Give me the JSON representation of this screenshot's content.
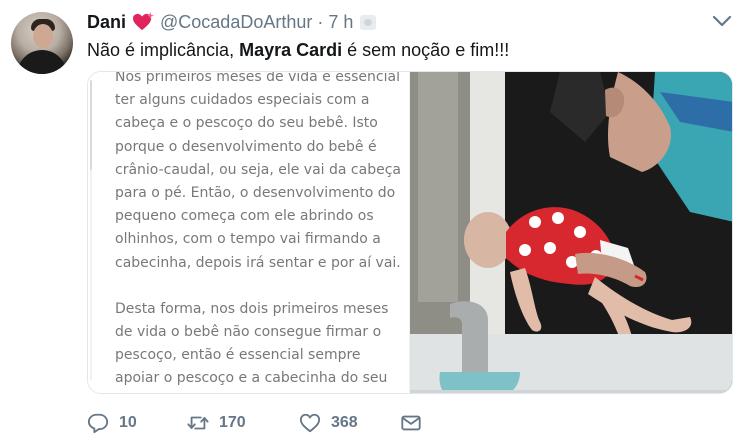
{
  "author": {
    "name": "Dani",
    "handle": "@CocadaDoArthur",
    "separator": "·",
    "time": "7 h"
  },
  "tweet": {
    "text_before": "Não é implicância, ",
    "text_bold": "Mayra Cardi",
    "text_after": " é sem noção e fim!!!"
  },
  "media": {
    "article_paragraphs": [
      "Nos primeiros meses de vida é essencial ter alguns cuidados especiais com a cabeça e o pescoço do seu bebê. Isto porque o desenvolvimento do bebê é crânio-caudal, ou seja, ele vai da cabeça para o pé. Então, o desenvolvimento do pequeno começa com ele abrindo os olhinhos, com o tempo vai firmando a cabecinha, depois irá sentar e por aí vai.",
      "Desta forma, nos dois primeiros meses de vida o bebê não consegue firmar o pescoço, então é essencial sempre apoiar o pescoço e a cabecinha do seu bebê quando for segurá-lo. “Pelo pescoço"
    ]
  },
  "actions": {
    "replies": "10",
    "retweets": "170",
    "likes": "368"
  },
  "icons": {
    "heart_emoji": "sparkling-heart-icon",
    "reply": "reply-icon",
    "retweet": "retweet-icon",
    "like": "like-icon",
    "dm": "direct-message-icon",
    "menu": "chevron-down-icon"
  },
  "colors": {
    "text": "#14171a",
    "secondary": "#657786",
    "heart": "#e0245e",
    "border": "#e1e8ed"
  }
}
